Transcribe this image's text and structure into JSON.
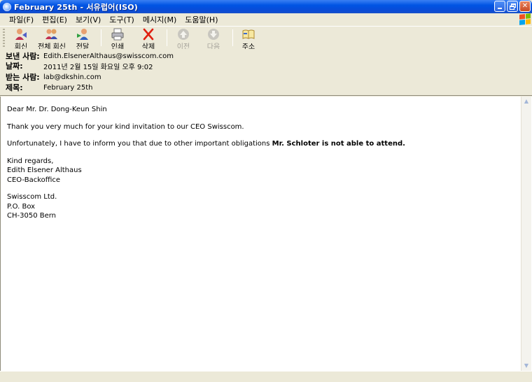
{
  "window": {
    "title": "February 25th  - 서유럽어(ISO)"
  },
  "menu": [
    "파일(F)",
    "편집(E)",
    "보기(V)",
    "도구(T)",
    "메시지(M)",
    "도움말(H)"
  ],
  "toolbar": {
    "reply": "회신",
    "reply_all": "전체 회신",
    "forward": "전달",
    "print": "인쇄",
    "delete": "삭제",
    "previous": "이전",
    "next": "다음",
    "addresses": "주소"
  },
  "header": {
    "from_label": "보낸 사람:",
    "from_value": "Edith.ElsenerAlthaus@swisscom.com",
    "date_label": "날짜:",
    "date_value": "2011년 2월 15일 화요일 오후 9:02",
    "to_label": "받는 사람:",
    "to_value": "lab@dkshin.com",
    "subject_label": "제목:",
    "subject_value": "February 25th"
  },
  "message": {
    "greeting": "Dear Mr. Dr. Dong-Keun Shin",
    "line1": "Thank you very much for your kind invitation to our CEO Swisscom.",
    "line2_prefix": "Unfortunately, I have to inform you that due to other important obligations ",
    "line2_bold": "Mr. Schloter is not able to attend.",
    "closing": "Kind regards,",
    "sig_name": "Edith Elsener Althaus",
    "sig_title": "CEO-Backoffice",
    "company": "Swisscom Ltd.",
    "po_box": "P.O. Box",
    "city": "CH-3050 Bern"
  }
}
